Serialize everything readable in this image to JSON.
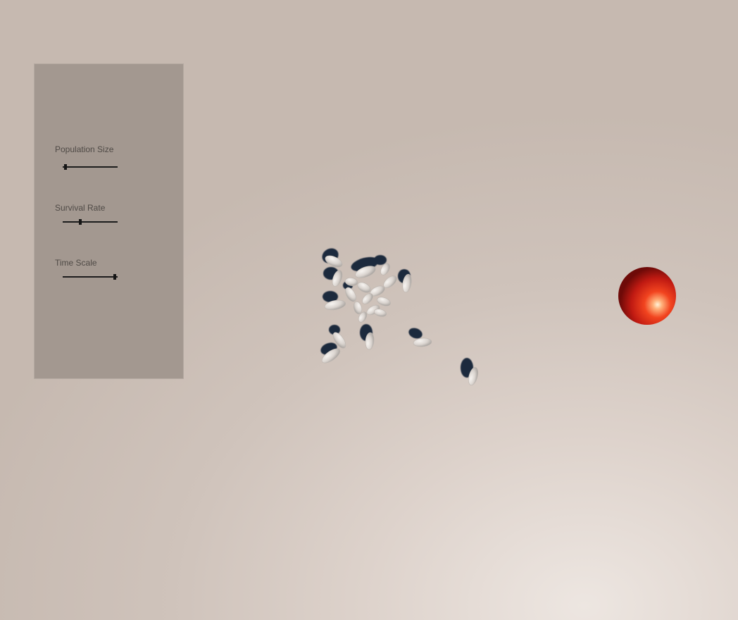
{
  "controls_panel": {
    "sliders": [
      {
        "label": "Population Size",
        "value": 0.05
      },
      {
        "label": "Survival Rate",
        "value": 0.32
      },
      {
        "label": "Time Scale",
        "value": 0.95
      }
    ]
  },
  "scene": {
    "agent_color": "#e6e1dc",
    "agent_shadow_color": "#1d2a3c",
    "target_color": "#e8301c"
  }
}
